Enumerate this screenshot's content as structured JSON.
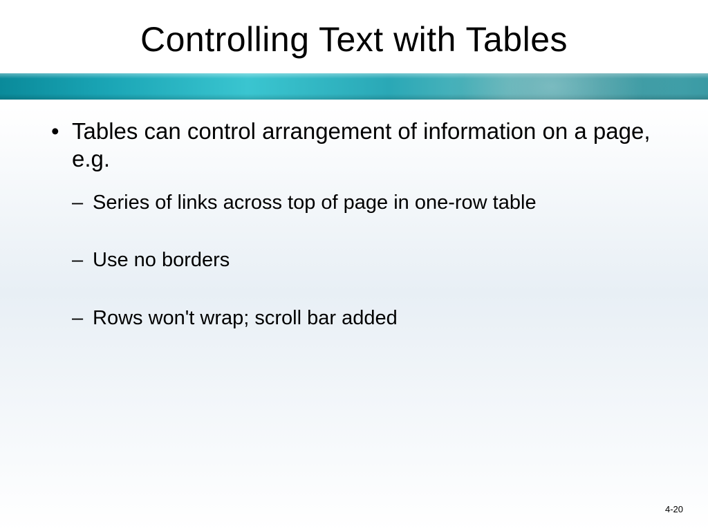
{
  "slide": {
    "title": "Controlling Text with Tables",
    "bullets": [
      {
        "text": "Tables can control arrangement of information on a page, e.g.",
        "sub": [
          "Series of links across top of page in one-row table",
          "Use no borders",
          "Rows won't wrap; scroll bar added"
        ]
      }
    ],
    "page_number": "4-20"
  }
}
